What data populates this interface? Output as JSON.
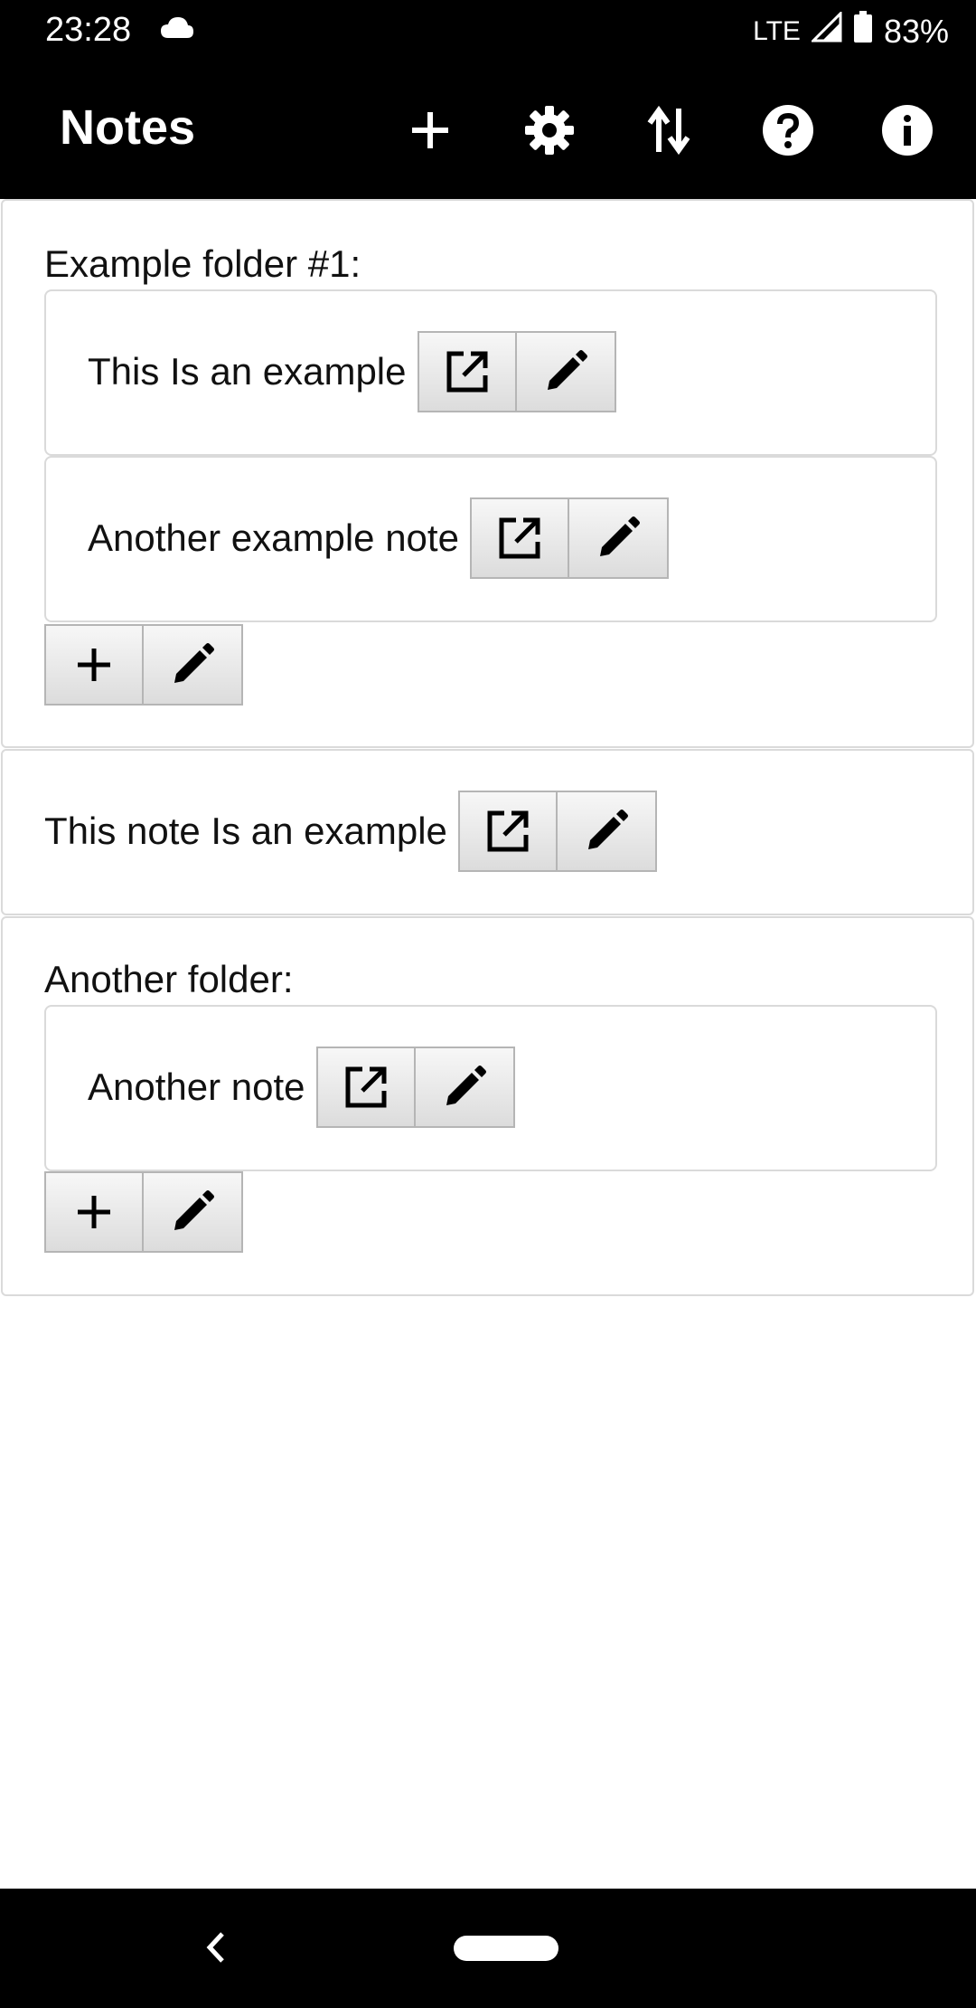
{
  "status": {
    "time": "23:28",
    "network": "LTE",
    "battery": "83%"
  },
  "app": {
    "title": "Notes",
    "actions": [
      "add-icon",
      "settings-icon",
      "sort-icon",
      "help-icon",
      "info-icon"
    ]
  },
  "folders": [
    {
      "title": "Example folder #1:",
      "notes": [
        {
          "label": "This Is an example"
        },
        {
          "label": "Another example note"
        }
      ]
    },
    {
      "title": "Another folder:",
      "notes": [
        {
          "label": "Another note"
        }
      ]
    }
  ],
  "standalone_note": {
    "label": "This note Is an example"
  },
  "colors": {
    "bar_bg": "#000000",
    "border": "#dadada",
    "button_bg": "#e6e6e6"
  }
}
